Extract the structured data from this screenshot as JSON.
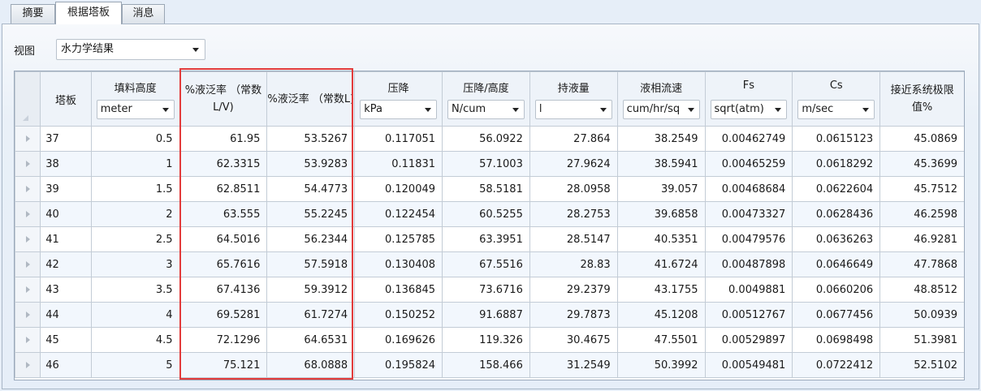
{
  "tabs": [
    "摘要",
    "根据塔板",
    "消息"
  ],
  "active_tab": 1,
  "view": {
    "label": "视图",
    "selected": "水力学结果"
  },
  "columns": [
    {
      "title": "塔板",
      "unit": null
    },
    {
      "title": "填料高度",
      "unit": "meter"
    },
    {
      "title": "%液泛率 （常数L/V)",
      "unit": null
    },
    {
      "title": "%液泛率 （常数L)",
      "unit": null
    },
    {
      "title": "压降",
      "unit": "kPa"
    },
    {
      "title": "压降/高度",
      "unit": "N/cum"
    },
    {
      "title": "持液量",
      "unit": "l"
    },
    {
      "title": "液相流速",
      "unit": "cum/hr/sq"
    },
    {
      "title": "Fs",
      "unit": "sqrt(atm)"
    },
    {
      "title": "Cs",
      "unit": "m/sec"
    },
    {
      "title": "接近系统极限值%",
      "unit": null
    }
  ],
  "rows": [
    [
      "37",
      "0.5",
      "61.95",
      "53.5267",
      "0.117051",
      "56.0922",
      "27.864",
      "38.2549",
      "0.00462749",
      "0.0615123",
      "45.0869"
    ],
    [
      "38",
      "1",
      "62.3315",
      "53.9283",
      "0.11831",
      "57.1003",
      "27.9624",
      "38.5941",
      "0.00465259",
      "0.0618292",
      "45.3699"
    ],
    [
      "39",
      "1.5",
      "62.8511",
      "54.4773",
      "0.120049",
      "58.5181",
      "28.0958",
      "39.057",
      "0.00468684",
      "0.0622604",
      "45.7512"
    ],
    [
      "40",
      "2",
      "63.555",
      "55.2245",
      "0.122454",
      "60.5255",
      "28.2753",
      "39.6858",
      "0.00473327",
      "0.0628436",
      "46.2598"
    ],
    [
      "41",
      "2.5",
      "64.5016",
      "56.2344",
      "0.125785",
      "63.3951",
      "28.5147",
      "40.5351",
      "0.00479576",
      "0.0636263",
      "46.9281"
    ],
    [
      "42",
      "3",
      "65.7616",
      "57.5918",
      "0.130408",
      "67.5516",
      "28.83",
      "41.6724",
      "0.00487898",
      "0.0646649",
      "47.7868"
    ],
    [
      "43",
      "3.5",
      "67.4136",
      "59.3912",
      "0.136845",
      "73.6716",
      "29.2379",
      "43.1755",
      "0.0049881",
      "0.0660206",
      "48.8512"
    ],
    [
      "44",
      "4",
      "69.5281",
      "61.7274",
      "0.150252",
      "91.6887",
      "29.7873",
      "45.1208",
      "0.00512767",
      "0.0677456",
      "50.0939"
    ],
    [
      "45",
      "4.5",
      "72.1296",
      "64.6531",
      "0.169626",
      "119.326",
      "30.4675",
      "47.5501",
      "0.00529897",
      "0.0698498",
      "51.3981"
    ],
    [
      "46",
      "5",
      "75.121",
      "68.0888",
      "0.195824",
      "158.466",
      "31.2549",
      "50.3992",
      "0.00549481",
      "0.0722412",
      "52.5102"
    ]
  ],
  "highlight_color": "#e23b3b"
}
